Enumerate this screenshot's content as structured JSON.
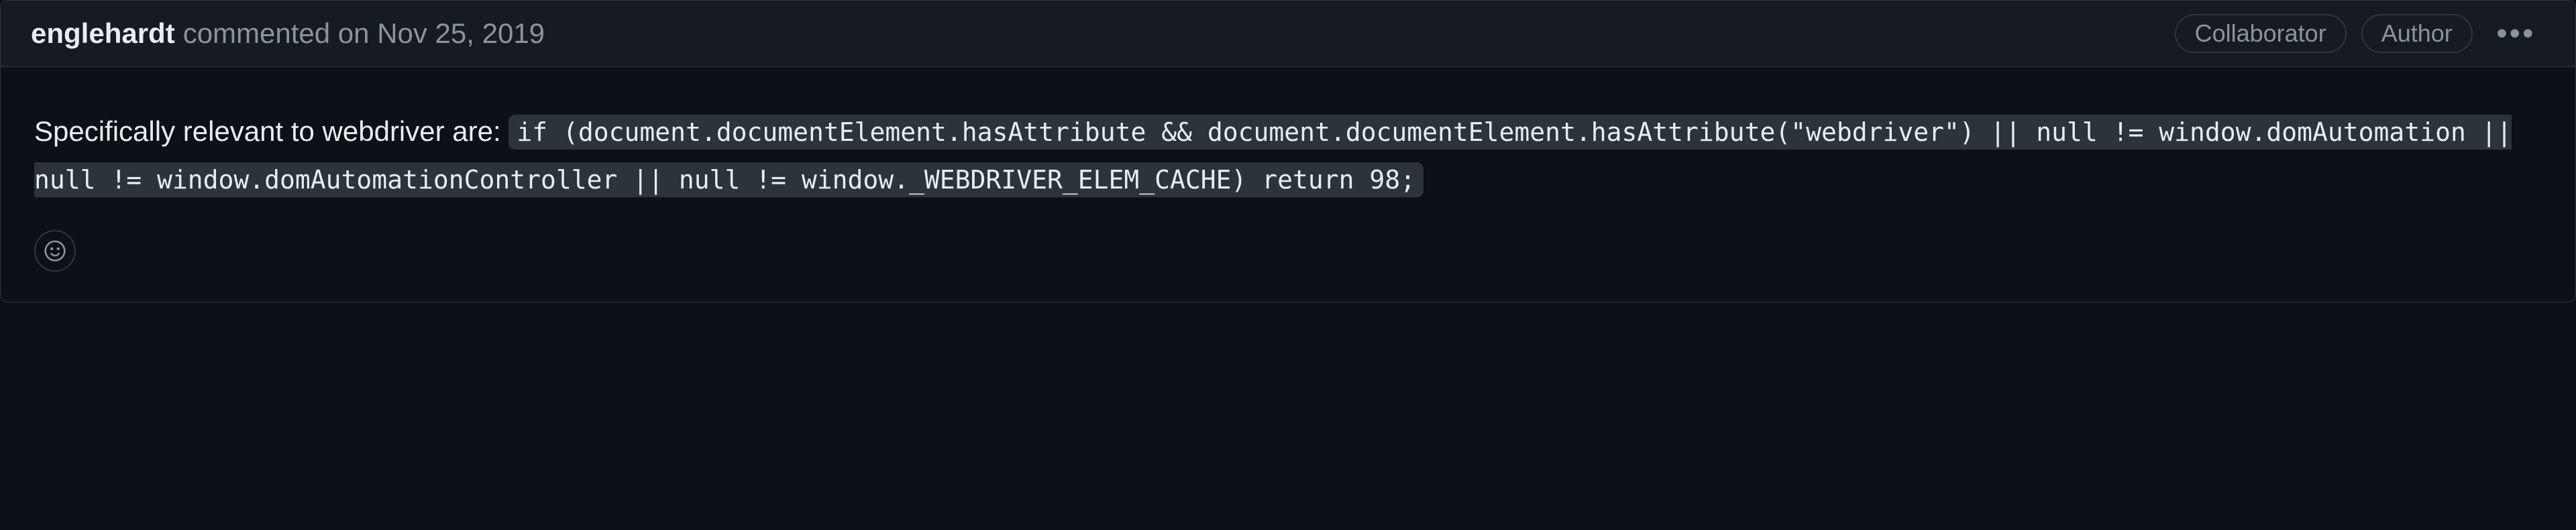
{
  "header": {
    "author": "englehardt",
    "action_text": "commented on Nov 25, 2019",
    "badges": {
      "collaborator": "Collaborator",
      "author": "Author"
    }
  },
  "body": {
    "intro_text": "Specifically relevant to webdriver are: ",
    "code": "if (document.documentElement.hasAttribute && document.documentElement.hasAttribute(\"webdriver\") || null != window.domAutomation || null != window.domAutomationController || null != window._WEBDRIVER_ELEM_CACHE) return 98;"
  },
  "icons": {
    "kebab": "•••"
  }
}
